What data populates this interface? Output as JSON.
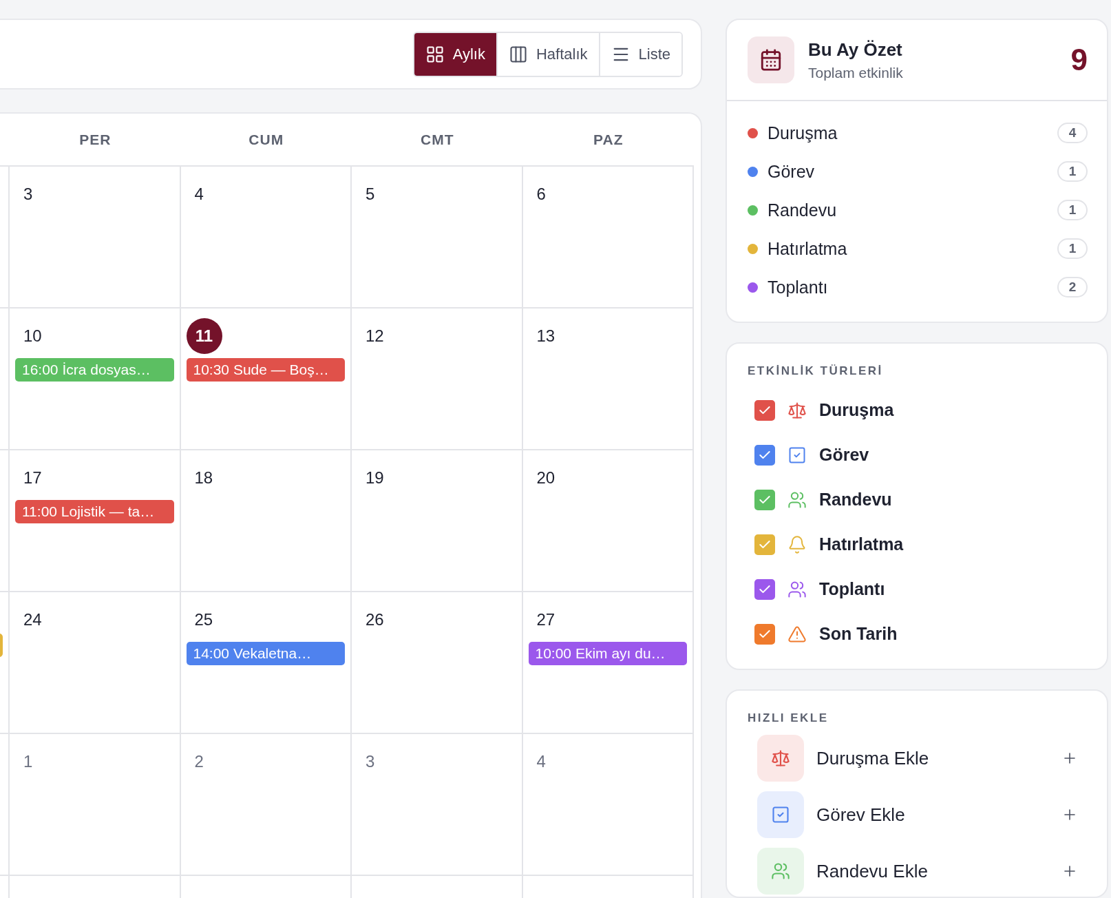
{
  "view_switcher": [
    {
      "label": "Aylık",
      "kind": "grid",
      "selected": true
    },
    {
      "label": "Haftalık",
      "kind": "columns",
      "selected": false
    },
    {
      "label": "Liste",
      "kind": "list",
      "selected": false
    }
  ],
  "calendar": {
    "weekdays": [
      "PER",
      "CUM",
      "CMT",
      "PAZ"
    ],
    "weeks": [
      {
        "days": [
          {
            "date": "3",
            "muted": false,
            "today": false
          },
          {
            "date": "4",
            "muted": false,
            "today": false
          },
          {
            "date": "5",
            "muted": false,
            "today": false
          },
          {
            "date": "6",
            "muted": false,
            "today": false
          }
        ]
      },
      {
        "days": [
          {
            "date": "10",
            "muted": false,
            "today": false,
            "events": [
              {
                "text": "16:00 İcra dosyas…",
                "color": "#5cbf62"
              }
            ]
          },
          {
            "date": "11",
            "muted": false,
            "today": true,
            "events": [
              {
                "text": "10:30 Sude — Boş…",
                "color": "#e0514a"
              }
            ]
          },
          {
            "date": "12",
            "muted": false,
            "today": false
          },
          {
            "date": "13",
            "muted": false,
            "today": false
          }
        ]
      },
      {
        "days": [
          {
            "date": "17",
            "muted": false,
            "today": false,
            "events": [
              {
                "text": "11:00 Lojistik — ta…",
                "color": "#e0514a"
              }
            ]
          },
          {
            "date": "18",
            "muted": false,
            "today": false
          },
          {
            "date": "19",
            "muted": false,
            "today": false
          },
          {
            "date": "20",
            "muted": false,
            "today": false
          }
        ]
      },
      {
        "edge_events": [
          {
            "color": "#e3b53b"
          }
        ],
        "days": [
          {
            "date": "24",
            "muted": false,
            "today": false
          },
          {
            "date": "25",
            "muted": false,
            "today": false,
            "events": [
              {
                "text": "14:00 Vekaletna…",
                "color": "#4f82ee"
              }
            ]
          },
          {
            "date": "26",
            "muted": false,
            "today": false
          },
          {
            "date": "27",
            "muted": false,
            "today": false,
            "events": [
              {
                "text": "10:00 Ekim ayı du…",
                "color": "#9b58ec"
              }
            ]
          }
        ]
      },
      {
        "days": [
          {
            "date": "1",
            "muted": true,
            "today": false
          },
          {
            "date": "2",
            "muted": true,
            "today": false
          },
          {
            "date": "3",
            "muted": true,
            "today": false
          },
          {
            "date": "4",
            "muted": true,
            "today": false
          }
        ]
      }
    ]
  },
  "summary": {
    "title": "Bu Ay Özet",
    "subtitle": "Toplam etkinlik",
    "total": "9",
    "counts": [
      {
        "label": "Duruşma",
        "color": "#e0514a",
        "count": "4"
      },
      {
        "label": "Görev",
        "color": "#4f82ee",
        "count": "1"
      },
      {
        "label": "Randevu",
        "color": "#5cbf62",
        "count": "1"
      },
      {
        "label": "Hatırlatma",
        "color": "#e3b53b",
        "count": "1"
      },
      {
        "label": "Toplantı",
        "color": "#9b58ec",
        "count": "2"
      }
    ]
  },
  "event_types": {
    "heading": "ETKİNLİK TÜRLERİ",
    "items": [
      {
        "label": "Duruşma",
        "kind": "scale",
        "color": "#e0514a",
        "checked": true
      },
      {
        "label": "Görev",
        "kind": "task",
        "color": "#4f82ee",
        "checked": true
      },
      {
        "label": "Randevu",
        "kind": "people",
        "color": "#5cbf62",
        "checked": true
      },
      {
        "label": "Hatırlatma",
        "kind": "bell",
        "color": "#e3b53b",
        "checked": true
      },
      {
        "label": "Toplantı",
        "kind": "people",
        "color": "#9b58ec",
        "checked": true
      },
      {
        "label": "Son Tarih",
        "kind": "warning",
        "color": "#ef7a2c",
        "checked": true
      }
    ]
  },
  "quick_add": {
    "heading": "HIZLI EKLE",
    "items": [
      {
        "label": "Duruşma Ekle",
        "kind": "scale",
        "color": "#e0514a"
      },
      {
        "label": "Görev Ekle",
        "kind": "task",
        "color": "#4f82ee"
      },
      {
        "label": "Randevu Ekle",
        "kind": "people",
        "color": "#5cbf62"
      }
    ]
  }
}
